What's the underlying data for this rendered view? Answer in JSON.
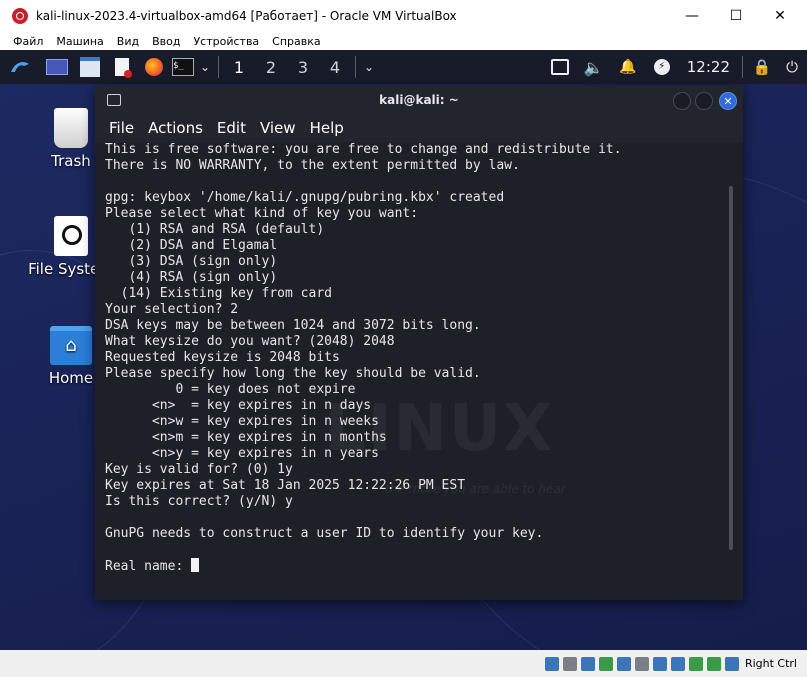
{
  "window": {
    "title": "kali-linux-2023.4-virtualbox-amd64 [Работает] - Oracle VM VirtualBox",
    "controls": {
      "minimize": "—",
      "maximize": "☐",
      "close": "✕"
    }
  },
  "host_menu": [
    "Файл",
    "Машина",
    "Вид",
    "Ввод",
    "Устройства",
    "Справка"
  ],
  "panel": {
    "workspaces": [
      "1",
      "2",
      "3",
      "4"
    ],
    "clock": "12:22",
    "icons": [
      "kali-menu-icon",
      "desktop-icon",
      "files-icon",
      "text-editor-icon",
      "firefox-icon",
      "terminal-icon"
    ]
  },
  "desktop": {
    "icons": [
      {
        "label": "Trash"
      },
      {
        "label": "File System"
      },
      {
        "label": "Home"
      }
    ]
  },
  "terminal": {
    "title": "kali@kali: ~",
    "menu": [
      "File",
      "Actions",
      "Edit",
      "View",
      "Help"
    ],
    "lines": [
      "This is free software: you are free to change and redistribute it.",
      "There is NO WARRANTY, to the extent permitted by law.",
      "",
      "gpg: keybox '/home/kali/.gnupg/pubring.kbx' created",
      "Please select what kind of key you want:",
      "   (1) RSA and RSA (default)",
      "   (2) DSA and Elgamal",
      "   (3) DSA (sign only)",
      "   (4) RSA (sign only)",
      "  (14) Existing key from card",
      "Your selection? 2",
      "DSA keys may be between 1024 and 3072 bits long.",
      "What keysize do you want? (2048) 2048",
      "Requested keysize is 2048 bits",
      "Please specify how long the key should be valid.",
      "         0 = key does not expire",
      "      <n>  = key expires in n days",
      "      <n>w = key expires in n weeks",
      "      <n>m = key expires in n months",
      "      <n>y = key expires in n years",
      "Key is valid for? (0) 1y",
      "Key expires at Sat 18 Jan 2025 12:22:26 PM EST",
      "Is this correct? (y/N) y",
      "",
      "GnuPG needs to construct a user ID to identify your key.",
      ""
    ],
    "prompt": "Real name: "
  },
  "statusbar": {
    "host_key": "Right Ctrl"
  }
}
